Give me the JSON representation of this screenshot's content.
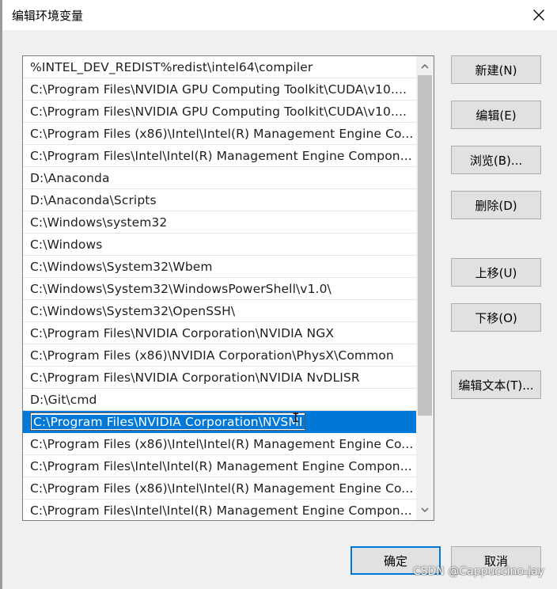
{
  "window": {
    "title": "编辑环境变量",
    "close_icon": "close-icon"
  },
  "list": {
    "items": [
      "%INTEL_DEV_REDIST%redist\\intel64\\compiler",
      "C:\\Program Files\\NVIDIA GPU Computing Toolkit\\CUDA\\v10....",
      "C:\\Program Files\\NVIDIA GPU Computing Toolkit\\CUDA\\v10....",
      "C:\\Program Files (x86)\\Intel\\Intel(R) Management Engine Co...",
      "C:\\Program Files\\Intel\\Intel(R) Management Engine Compon...",
      "D:\\Anaconda",
      "D:\\Anaconda\\Scripts",
      "C:\\Windows\\system32",
      "C:\\Windows",
      "C:\\Windows\\System32\\Wbem",
      "C:\\Windows\\System32\\WindowsPowerShell\\v1.0\\",
      "C:\\Windows\\System32\\OpenSSH\\",
      "C:\\Program Files\\NVIDIA Corporation\\NVIDIA NGX",
      "C:\\Program Files (x86)\\NVIDIA Corporation\\PhysX\\Common",
      "C:\\Program Files\\NVIDIA Corporation\\NVIDIA NvDLISR",
      "D:\\Git\\cmd",
      "C:\\Program Files\\NVIDIA Corporation\\NVSMI",
      "C:\\Program Files (x86)\\Intel\\Intel(R) Management Engine Co...",
      "C:\\Program Files\\Intel\\Intel(R) Management Engine Compon...",
      "C:\\Program Files (x86)\\Intel\\Intel(R) Management Engine Co...",
      "C:\\Program Files\\Intel\\Intel(R) Management Engine Compon..."
    ],
    "selected_index": 16,
    "editing_value": "C:\\Program Files\\NVIDIA Corporation\\NVSMI"
  },
  "scrollbar": {
    "up_icon": "chevron-up-icon",
    "down_icon": "chevron-down-icon"
  },
  "buttons": {
    "new": "新建(N)",
    "edit": "编辑(E)",
    "browse": "浏览(B)...",
    "delete": "删除(D)",
    "move_up": "上移(U)",
    "move_down": "下移(O)",
    "edit_text": "编辑文本(T)...",
    "ok": "确定",
    "cancel": "取消"
  },
  "watermark": "CSDN @Cappuccino-jay",
  "colors": {
    "selection": "#0078d7",
    "dialog_bg": "#f0f0f0",
    "button_bg": "#e1e1e1"
  }
}
